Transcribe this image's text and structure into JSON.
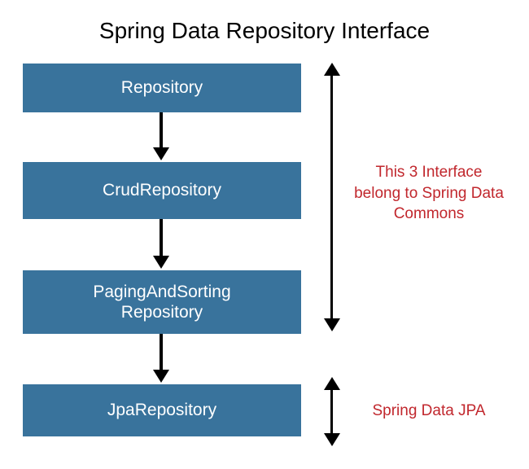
{
  "title": "Spring Data Repository Interface",
  "boxes": [
    {
      "label": "Repository"
    },
    {
      "label": "CrudRepository"
    },
    {
      "label": "PagingAndSorting\nRepository"
    },
    {
      "label": "JpaRepository"
    }
  ],
  "annotations": [
    {
      "text": "This 3 Interface belong to Spring Data Commons"
    },
    {
      "text": "Spring Data JPA"
    }
  ],
  "colors": {
    "box_bg": "#39739c",
    "box_text": "#ffffff",
    "annotation": "#c1272d",
    "arrow": "#000000"
  }
}
